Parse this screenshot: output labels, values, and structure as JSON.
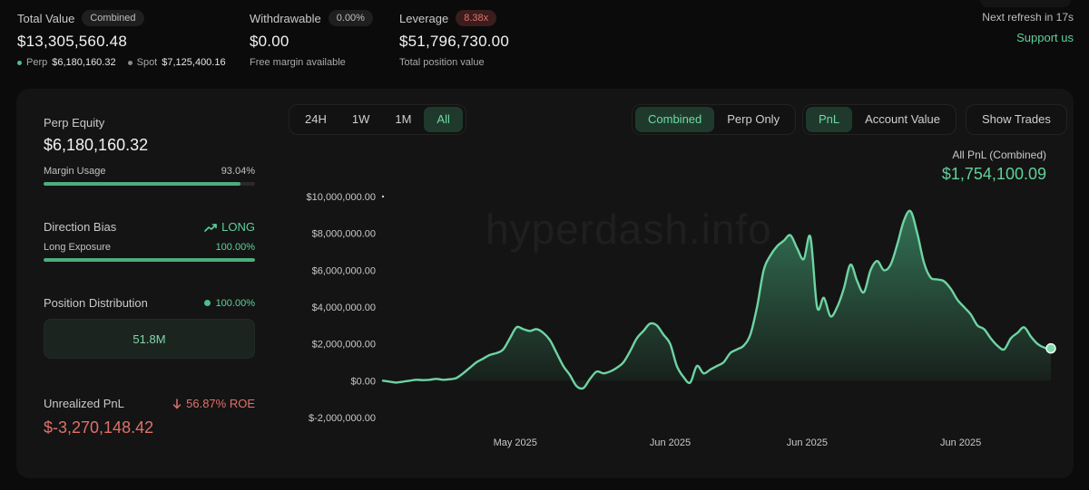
{
  "header": {
    "total_value": {
      "label": "Total Value",
      "badge": "Combined",
      "value": "$13,305,560.48",
      "perp_label": "Perp",
      "perp_value": "$6,180,160.32",
      "spot_label": "Spot",
      "spot_value": "$7,125,400.16"
    },
    "withdrawable": {
      "label": "Withdrawable",
      "badge": "0.00%",
      "value": "$0.00",
      "sub": "Free margin available"
    },
    "leverage": {
      "label": "Leverage",
      "badge": "8.38x",
      "value": "$51,796,730.00",
      "sub": "Total position value"
    },
    "refresh_text": "Next refresh in 17s",
    "support_link": "Support us"
  },
  "left_panel": {
    "perp_equity_label": "Perp Equity",
    "perp_equity_value": "$6,180,160.32",
    "margin_usage_label": "Margin Usage",
    "margin_usage_value": "93.04%",
    "margin_usage_fraction": 0.9304,
    "direction_bias_label": "Direction Bias",
    "direction_bias_value": "LONG",
    "long_exposure_label": "Long Exposure",
    "long_exposure_value": "100.00%",
    "long_exposure_fraction": 1.0,
    "position_distribution_label": "Position Distribution",
    "position_distribution_value": "100.00%",
    "position_distribution_box": "51.8M",
    "unrealized_pnl_label": "Unrealized PnL",
    "roe_value": "56.87% ROE",
    "unrealized_pnl_value": "$-3,270,148.42"
  },
  "controls": {
    "ranges": [
      "24H",
      "1W",
      "1M",
      "All"
    ],
    "range_active": "All",
    "scope": [
      "Combined",
      "Perp Only"
    ],
    "scope_active": "Combined",
    "metric": [
      "PnL",
      "Account Value"
    ],
    "metric_active": "PnL",
    "show_trades": "Show Trades"
  },
  "chart_summary": {
    "title": "All PnL (Combined)",
    "value": "$1,754,100.09"
  },
  "watermark": "hyperdash.info",
  "colors": {
    "accent": "#5fd19b",
    "negative": "#e0706a",
    "background": "#0b0b0b",
    "card": "#141414"
  },
  "chart_data": {
    "type": "area",
    "ylim": [
      -2000000,
      10000000
    ],
    "yticks": [
      10000000,
      8000000,
      6000000,
      4000000,
      2000000,
      0,
      -2000000
    ],
    "ytick_labels": [
      "$10,000,000.00",
      "$8,000,000.00",
      "$6,000,000.00",
      "$4,000,000.00",
      "$2,000,000.00",
      "$0.00",
      "$-2,000,000.00"
    ],
    "xtick_labels": [
      {
        "label": "May 2025",
        "pos": 0.198
      },
      {
        "label": "Jun 2025",
        "pos": 0.43
      },
      {
        "label": "Jun 2025",
        "pos": 0.635
      },
      {
        "label": "Jun 2025",
        "pos": 0.865
      }
    ],
    "x": [
      0,
      0.01,
      0.02,
      0.03,
      0.04,
      0.05,
      0.06,
      0.07,
      0.08,
      0.09,
      0.1,
      0.11,
      0.12,
      0.13,
      0.14,
      0.15,
      0.16,
      0.17,
      0.18,
      0.19,
      0.2,
      0.21,
      0.22,
      0.23,
      0.24,
      0.25,
      0.26,
      0.27,
      0.28,
      0.29,
      0.3,
      0.31,
      0.32,
      0.33,
      0.34,
      0.35,
      0.36,
      0.37,
      0.38,
      0.39,
      0.4,
      0.41,
      0.42,
      0.43,
      0.44,
      0.45,
      0.46,
      0.47,
      0.48,
      0.49,
      0.5,
      0.51,
      0.52,
      0.53,
      0.54,
      0.55,
      0.56,
      0.57,
      0.58,
      0.59,
      0.6,
      0.61,
      0.62,
      0.63,
      0.64,
      0.65,
      0.66,
      0.67,
      0.68,
      0.69,
      0.7,
      0.71,
      0.72,
      0.73,
      0.74,
      0.75,
      0.76,
      0.77,
      0.78,
      0.79,
      0.8,
      0.81,
      0.82,
      0.83,
      0.84,
      0.85,
      0.86,
      0.87,
      0.88,
      0.89,
      0.9,
      0.91,
      0.92,
      0.93,
      0.94,
      0.95,
      0.96,
      0.97,
      0.98,
      0.99,
      1.0
    ],
    "y": [
      0,
      -50000,
      -100000,
      -50000,
      0,
      50000,
      30000,
      50000,
      100000,
      50000,
      80000,
      150000,
      400000,
      700000,
      1000000,
      1200000,
      1400000,
      1500000,
      1700000,
      2300000,
      2900000,
      2800000,
      2700000,
      2800000,
      2600000,
      2200000,
      1500000,
      800000,
      300000,
      -300000,
      -400000,
      100000,
      500000,
      400000,
      500000,
      700000,
      1000000,
      1600000,
      2300000,
      2700000,
      3100000,
      3000000,
      2500000,
      2000000,
      800000,
      200000,
      -100000,
      800000,
      400000,
      600000,
      800000,
      1000000,
      1500000,
      1700000,
      1900000,
      2500000,
      4000000,
      6000000,
      6800000,
      7300000,
      7600000,
      7900000,
      7200000,
      6600000,
      7800000,
      4000000,
      4500000,
      3500000,
      4000000,
      5000000,
      6300000,
      5400000,
      4800000,
      6000000,
      6500000,
      6000000,
      6300000,
      7400000,
      8700000,
      9200000,
      8000000,
      6400000,
      5600000,
      5500000,
      5400000,
      5000000,
      4400000,
      4000000,
      3600000,
      3000000,
      2800000,
      2300000,
      1900000,
      1700000,
      2300000,
      2600000,
      2900000,
      2400000,
      2000000,
      1800000,
      1754100
    ]
  }
}
